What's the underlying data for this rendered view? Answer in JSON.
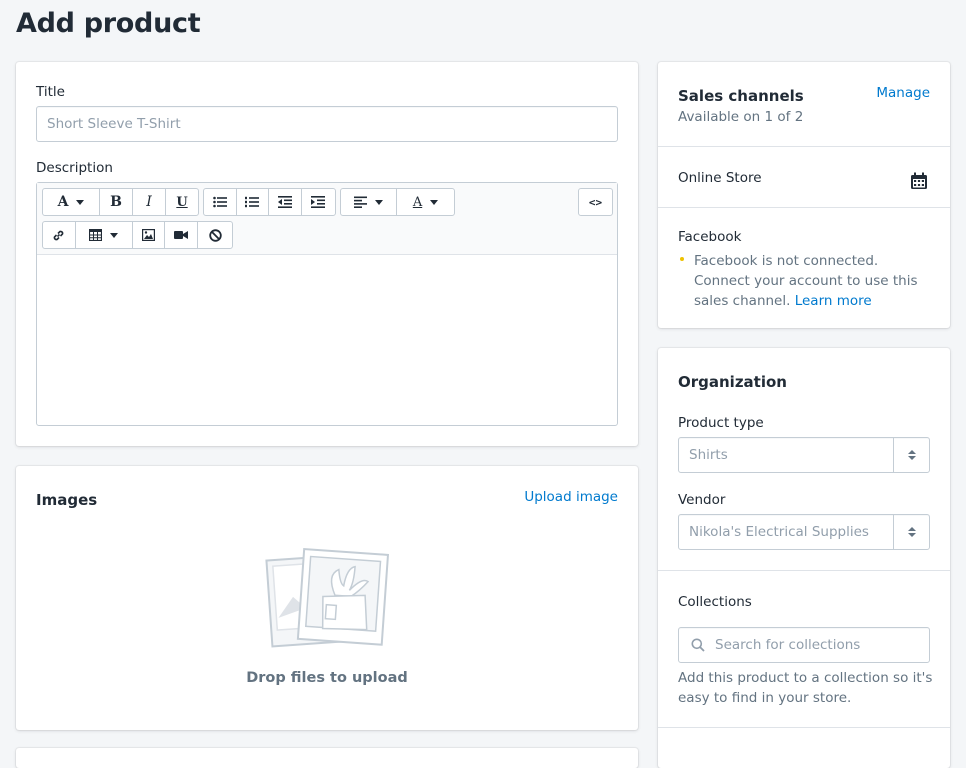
{
  "page": {
    "title": "Add product"
  },
  "product": {
    "title_label": "Title",
    "title_placeholder": "Short Sleeve T-Shirt",
    "description_label": "Description",
    "toolbar": {
      "font_label": "A",
      "bold_label": "B",
      "italic_label": "I",
      "underline_label": "U",
      "color_label": "A",
      "html_label": "<>"
    }
  },
  "images": {
    "title": "Images",
    "upload_link": "Upload image",
    "drop_text": "Drop files to upload"
  },
  "sales_channels": {
    "title": "Sales channels",
    "manage_link": "Manage",
    "availability": "Available on 1 of 2",
    "online_store": "Online Store",
    "facebook_title": "Facebook",
    "facebook_line1": "Facebook is not connected.",
    "facebook_line2": "Connect your account to use this",
    "facebook_line3": "sales channel.",
    "learn_more": "Learn more"
  },
  "organization": {
    "title": "Organization",
    "product_type_label": "Product type",
    "product_type_placeholder": "Shirts",
    "vendor_label": "Vendor",
    "vendor_placeholder": "Nikola's Electrical Supplies",
    "collections_label": "Collections",
    "collections_placeholder": "Search for collections",
    "collections_help_line1": "Add this product to a collection so it's",
    "collections_help_line2": "easy to find in your store."
  },
  "colors": {
    "link": "#007ace",
    "text": "#212b36",
    "muted": "#637381",
    "warning_dot": "#eec200",
    "background": "#f4f6f8"
  }
}
